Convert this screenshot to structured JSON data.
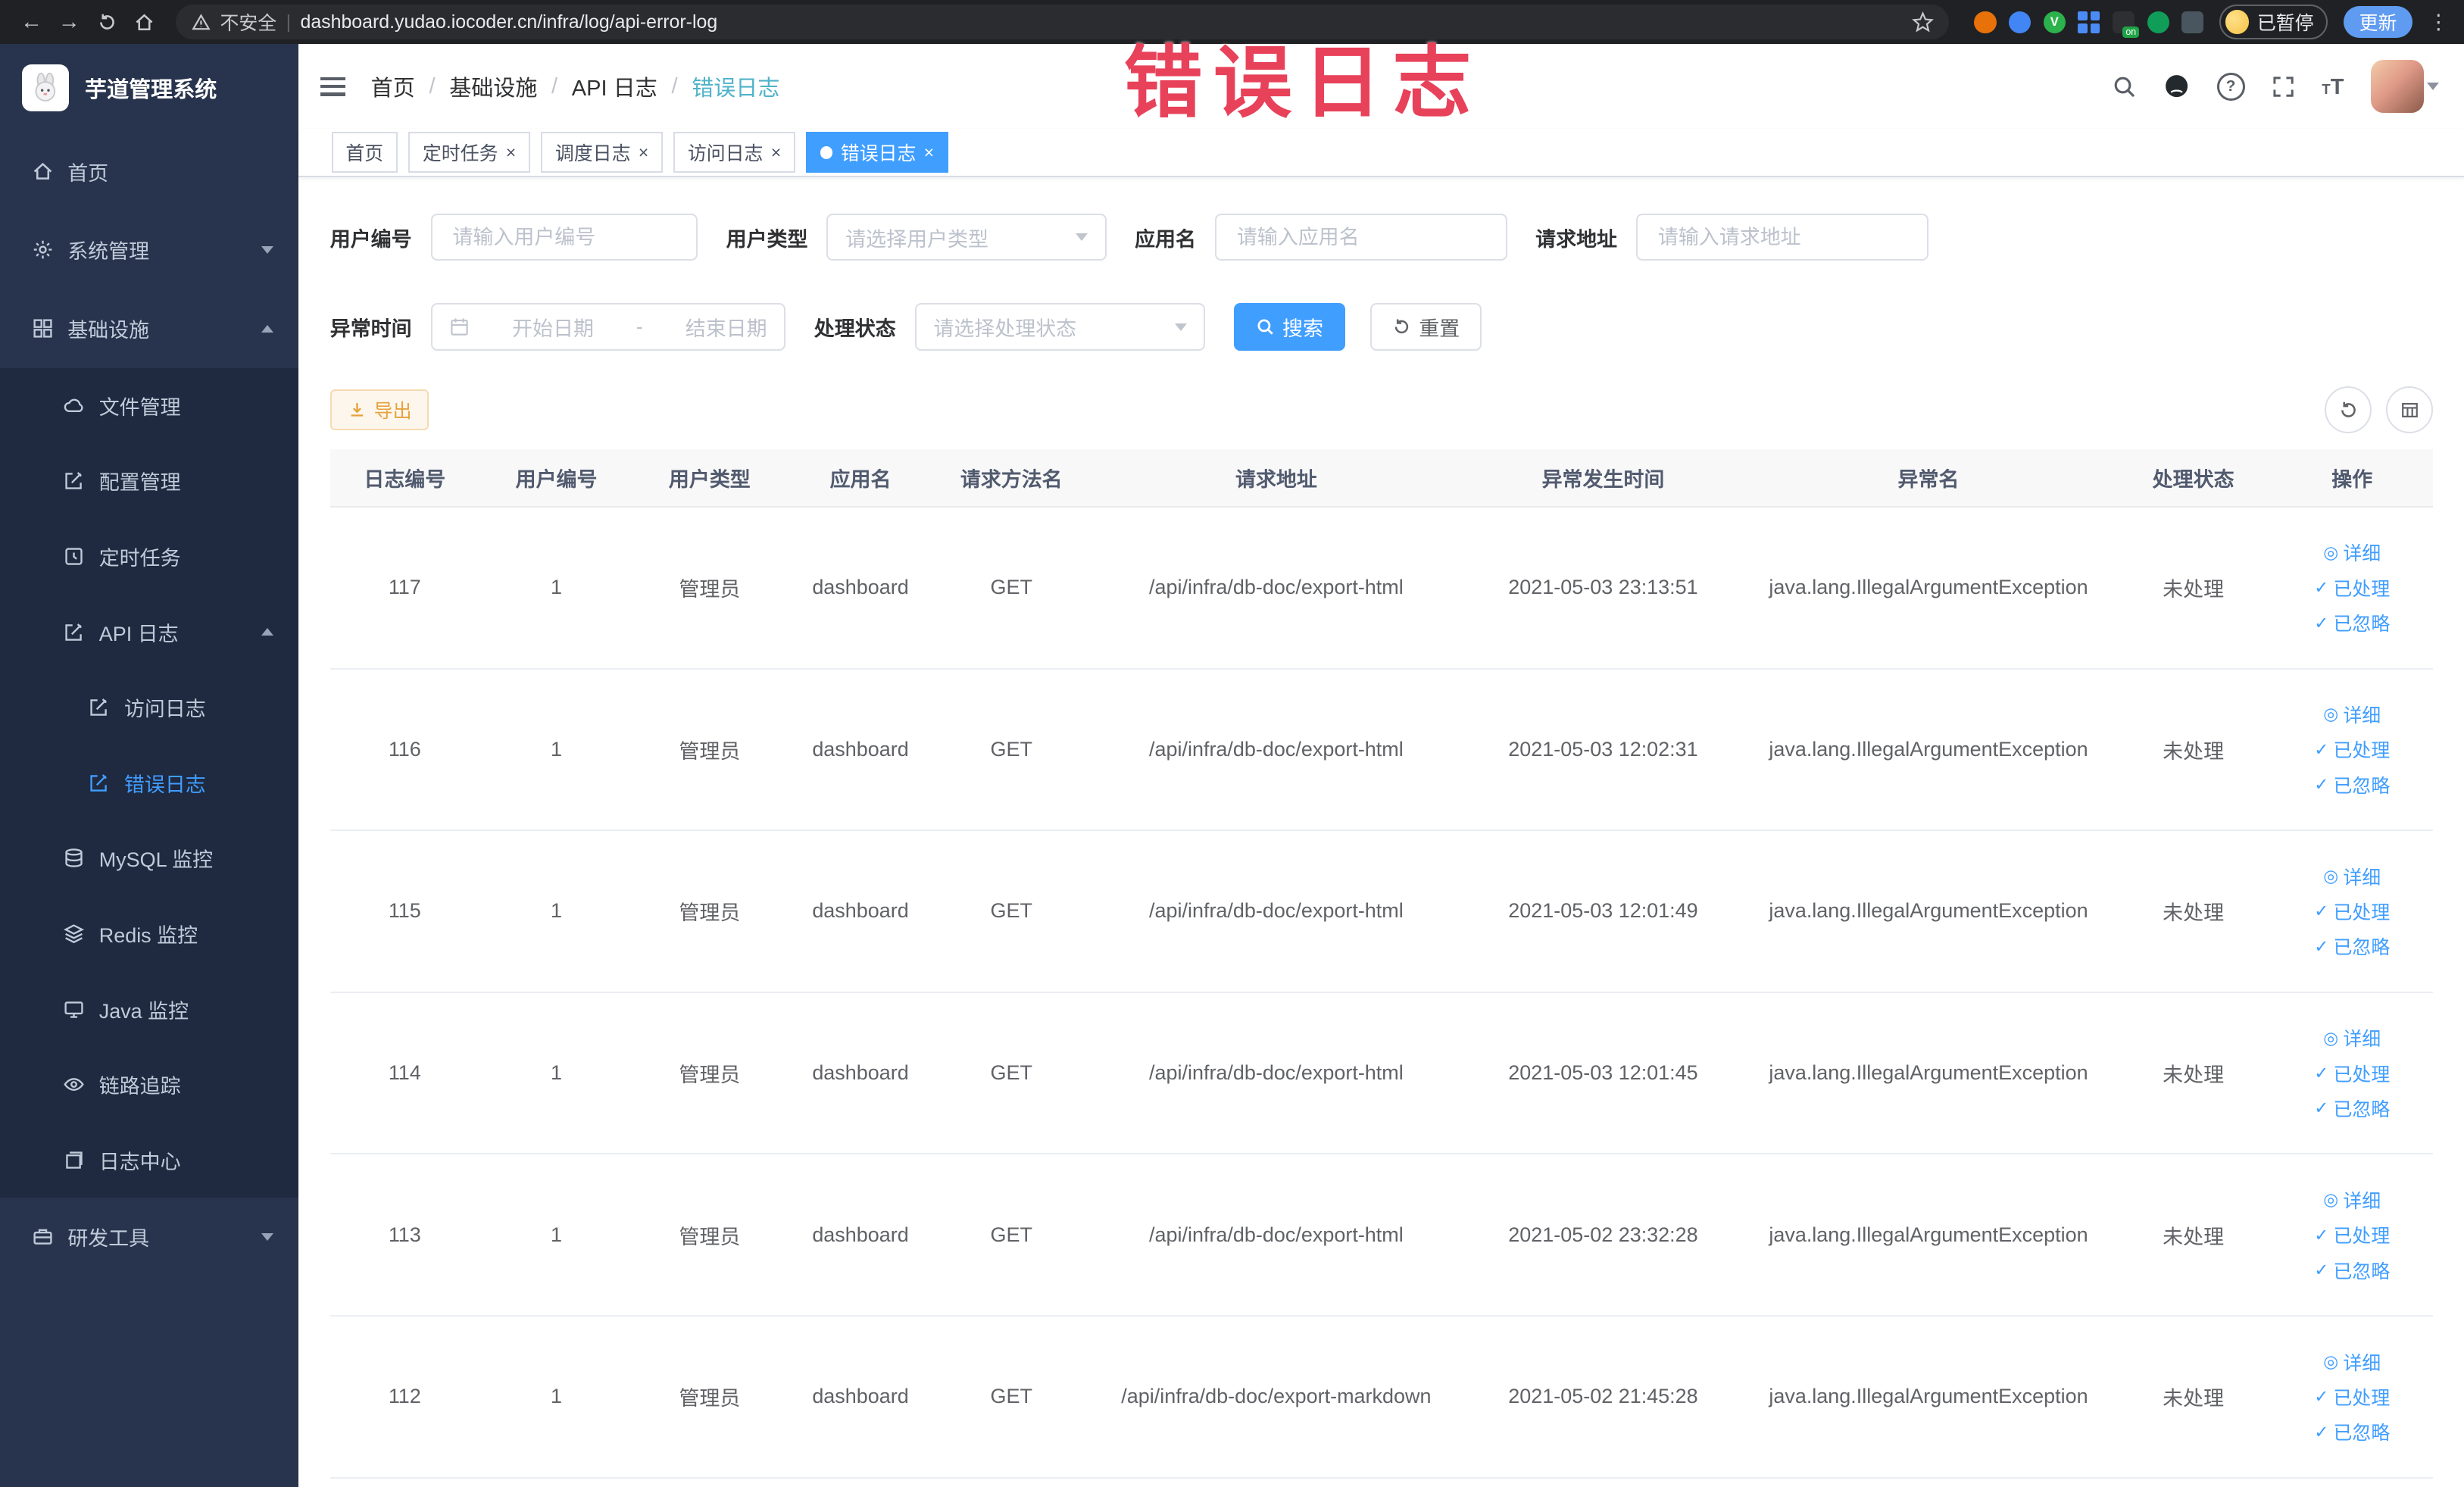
{
  "colors": {
    "accent": "#409eff",
    "watermark_red": "#e8415a",
    "warning": "#e6a23c",
    "sidebar_bg": "#28344d"
  },
  "browser": {
    "security_label": "不安全",
    "url": "dashboard.yudao.iocoder.cn/infra/log/api-error-log",
    "profile_badge": "已暂停",
    "update_label": "更新"
  },
  "watermark": {
    "text": "错误日志"
  },
  "sidebar": {
    "logo_title": "芋道管理系统",
    "items": [
      {
        "label": "首页",
        "icon": "home-icon",
        "level": 0
      },
      {
        "label": "系统管理",
        "icon": "gear-icon",
        "level": 0,
        "arrow": "down"
      },
      {
        "label": "基础设施",
        "icon": "grid-icon",
        "level": 0,
        "arrow": "up"
      },
      {
        "label": "文件管理",
        "icon": "cloud-icon",
        "level": 1
      },
      {
        "label": "配置管理",
        "icon": "edit-icon",
        "level": 1
      },
      {
        "label": "定时任务",
        "icon": "schedule-icon",
        "level": 1
      },
      {
        "label": "API 日志",
        "icon": "doc-edit-icon",
        "level": 1,
        "arrow": "up"
      },
      {
        "label": "访问日志",
        "icon": "doc-edit-icon",
        "level": 2
      },
      {
        "label": "错误日志",
        "icon": "doc-edit-icon",
        "level": 2,
        "active": true
      },
      {
        "label": "MySQL 监控",
        "icon": "database-icon",
        "level": 1
      },
      {
        "label": "Redis 监控",
        "icon": "layers-icon",
        "level": 1
      },
      {
        "label": "Java 监控",
        "icon": "monitor-icon",
        "level": 1
      },
      {
        "label": "链路追踪",
        "icon": "eye-icon",
        "level": 1
      },
      {
        "label": "日志中心",
        "icon": "doc-stack-icon",
        "level": 1
      },
      {
        "label": "研发工具",
        "icon": "toolbox-icon",
        "level": 0,
        "arrow": "down"
      }
    ]
  },
  "navbar": {
    "breadcrumb": [
      "首页",
      "基础设施",
      "API 日志",
      "错误日志"
    ]
  },
  "tabs": [
    {
      "label": "首页",
      "closable": false,
      "active": false
    },
    {
      "label": "定时任务",
      "closable": true,
      "active": false
    },
    {
      "label": "调度日志",
      "closable": true,
      "active": false
    },
    {
      "label": "访问日志",
      "closable": true,
      "active": false
    },
    {
      "label": "错误日志",
      "closable": true,
      "active": true
    }
  ],
  "filters": {
    "user_id_label": "用户编号",
    "user_id_placeholder": "请输入用户编号",
    "user_type_label": "用户类型",
    "user_type_placeholder": "请选择用户类型",
    "app_name_label": "应用名",
    "app_name_placeholder": "请输入应用名",
    "request_url_label": "请求地址",
    "request_url_placeholder": "请输入请求地址",
    "exception_time_label": "异常时间",
    "start_date_placeholder": "开始日期",
    "range_separator": "-",
    "end_date_placeholder": "结束日期",
    "process_status_label": "处理状态",
    "process_status_placeholder": "请选择处理状态",
    "search_button": "搜索",
    "reset_button": "重置"
  },
  "toolbar": {
    "export_button": "导出"
  },
  "table": {
    "headers": [
      "日志编号",
      "用户编号",
      "用户类型",
      "应用名",
      "请求方法名",
      "请求地址",
      "异常发生时间",
      "异常名",
      "处理状态",
      "操作"
    ],
    "action_labels": [
      "详细",
      "已处理",
      "已忽略"
    ],
    "rows": [
      {
        "log_id": "117",
        "user_id": "1",
        "user_type": "管理员",
        "app_name": "dashboard",
        "method": "GET",
        "url": "/api/infra/db-doc/export-html",
        "time": "2021-05-03 23:13:51",
        "exception": "java.lang.IllegalArgumentException",
        "status": "未处理"
      },
      {
        "log_id": "116",
        "user_id": "1",
        "user_type": "管理员",
        "app_name": "dashboard",
        "method": "GET",
        "url": "/api/infra/db-doc/export-html",
        "time": "2021-05-03 12:02:31",
        "exception": "java.lang.IllegalArgumentException",
        "status": "未处理"
      },
      {
        "log_id": "115",
        "user_id": "1",
        "user_type": "管理员",
        "app_name": "dashboard",
        "method": "GET",
        "url": "/api/infra/db-doc/export-html",
        "time": "2021-05-03 12:01:49",
        "exception": "java.lang.IllegalArgumentException",
        "status": "未处理"
      },
      {
        "log_id": "114",
        "user_id": "1",
        "user_type": "管理员",
        "app_name": "dashboard",
        "method": "GET",
        "url": "/api/infra/db-doc/export-html",
        "time": "2021-05-03 12:01:45",
        "exception": "java.lang.IllegalArgumentException",
        "status": "未处理"
      },
      {
        "log_id": "113",
        "user_id": "1",
        "user_type": "管理员",
        "app_name": "dashboard",
        "method": "GET",
        "url": "/api/infra/db-doc/export-html",
        "time": "2021-05-02 23:32:28",
        "exception": "java.lang.IllegalArgumentException",
        "status": "未处理"
      },
      {
        "log_id": "112",
        "user_id": "1",
        "user_type": "管理员",
        "app_name": "dashboard",
        "method": "GET",
        "url": "/api/infra/db-doc/export-markdown",
        "time": "2021-05-02 21:45:28",
        "exception": "java.lang.IllegalArgumentException",
        "status": "未处理"
      }
    ]
  }
}
